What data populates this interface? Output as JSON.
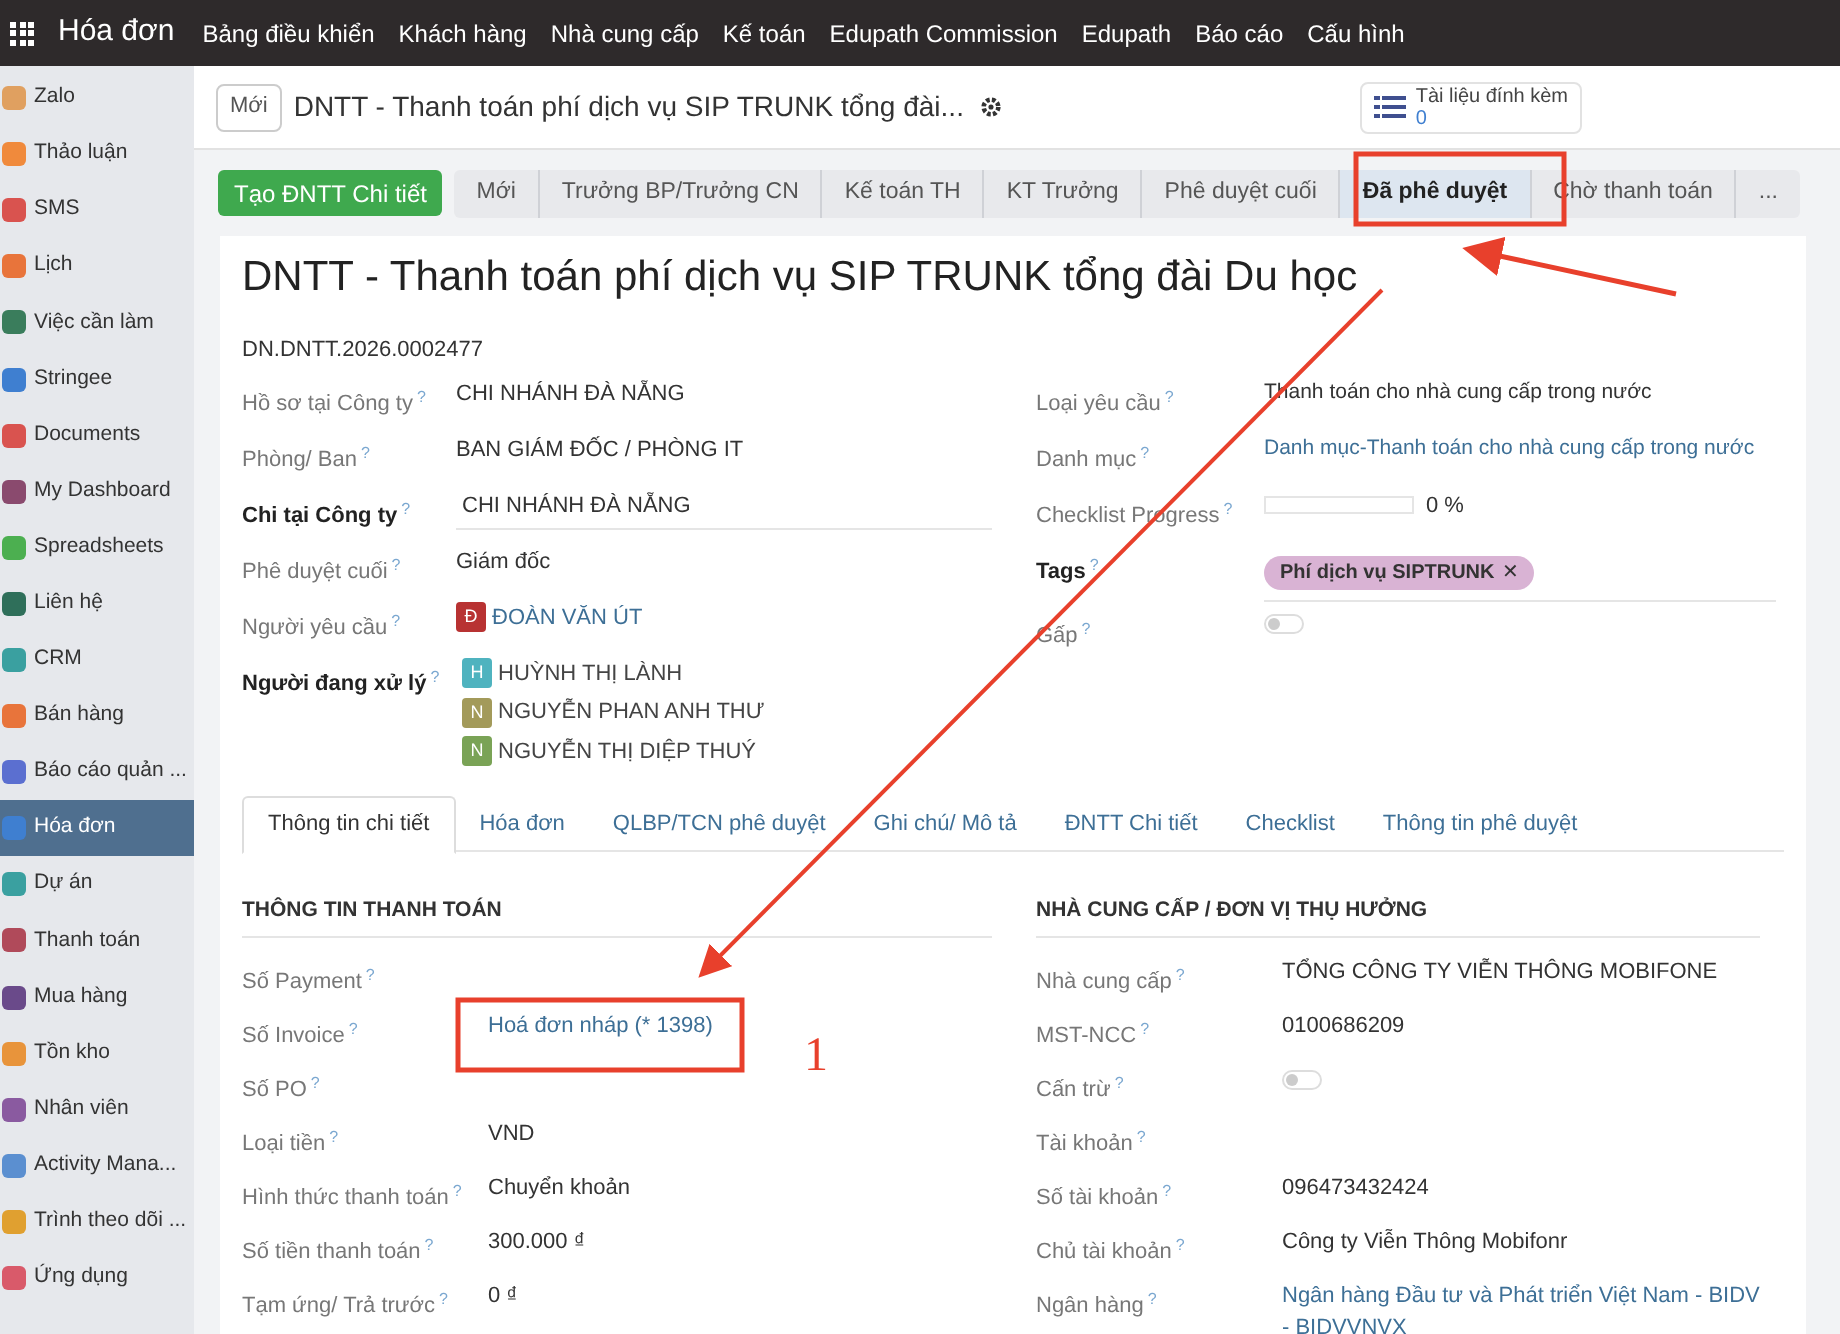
{
  "navbar": {
    "app_name": "Hóa đơn",
    "menu": [
      "Bảng điều khiển",
      "Khách hàng",
      "Nhà cung cấp",
      "Kế toán",
      "Edupath Commission",
      "Edupath",
      "Báo cáo",
      "Cấu hình"
    ]
  },
  "sidebar": {
    "items": [
      {
        "label": "Zalo",
        "color": "#e0a060",
        "selected": false
      },
      {
        "label": "Thảo luận",
        "color": "#f08a3c",
        "selected": false
      },
      {
        "label": "SMS",
        "color": "#d9534f",
        "selected": false
      },
      {
        "label": "Lịch",
        "color": "#e8743b",
        "selected": false
      },
      {
        "label": "Việc cần làm",
        "color": "#3a7d5c",
        "selected": false
      },
      {
        "label": "Stringee",
        "color": "#3f7fd0",
        "selected": false
      },
      {
        "label": "Documents",
        "color": "#d9534f",
        "selected": false
      },
      {
        "label": "My Dashboard",
        "color": "#8a4a6e",
        "selected": false
      },
      {
        "label": "Spreadsheets",
        "color": "#4caf50",
        "selected": false
      },
      {
        "label": "Liên hệ",
        "color": "#2f6f5a",
        "selected": false
      },
      {
        "label": "CRM",
        "color": "#3aa0a0",
        "selected": false
      },
      {
        "label": "Bán hàng",
        "color": "#e8743b",
        "selected": false
      },
      {
        "label": "Báo cáo quản ...",
        "color": "#5b6fd0",
        "selected": false
      },
      {
        "label": "Hóa đơn",
        "color": "#3f7fd0",
        "selected": true
      },
      {
        "label": "Dự án",
        "color": "#3aa0a0",
        "selected": false
      },
      {
        "label": "Thanh toán",
        "color": "#b04a5a",
        "selected": false
      },
      {
        "label": "Mua hàng",
        "color": "#6a4a8a",
        "selected": false
      },
      {
        "label": "Tồn kho",
        "color": "#e8943b",
        "selected": false
      },
      {
        "label": "Nhân viên",
        "color": "#8a5aa0",
        "selected": false
      },
      {
        "label": "Activity Mana...",
        "color": "#5b8fd0",
        "selected": false
      },
      {
        "label": "Trình theo dõi ...",
        "color": "#e0a030",
        "selected": false
      },
      {
        "label": "Ứng dụng",
        "color": "#d95a6a",
        "selected": false
      }
    ]
  },
  "control_panel": {
    "breadcrumb": "Mới",
    "title": "DNTT - Thanh toán phí dịch vụ SIP TRUNK tổng đài...",
    "attachments": {
      "label": "Tài liệu đính kèm",
      "count": "0"
    }
  },
  "action_button": "Tạo ĐNTT Chi tiết",
  "stages": [
    {
      "label": "Mới",
      "selected": false
    },
    {
      "label": "Trưởng BP/Trưởng CN",
      "selected": false
    },
    {
      "label": "Kế toán TH",
      "selected": false
    },
    {
      "label": "KT Trưởng",
      "selected": false
    },
    {
      "label": "Phê duyệt cuối",
      "selected": false
    },
    {
      "label": "Đã phê duyệt",
      "selected": true
    },
    {
      "label": "Chờ thanh toán",
      "selected": false
    },
    {
      "label": "...",
      "selected": false
    }
  ],
  "form": {
    "title": "DNTT - Thanh toán phí dịch vụ SIP TRUNK tổng đài Du học",
    "reference": "DN.DNTT.2026.0002477",
    "left_fields": [
      {
        "label": "Hồ sơ tại Công ty",
        "help": "?",
        "required": false,
        "kind": "text",
        "value": "CHI NHÁNH ĐÀ NẴNG"
      },
      {
        "label": "Phòng/ Ban",
        "help": "?",
        "required": false,
        "kind": "text",
        "value": "BAN GIÁM ĐỐC / PHÒNG IT"
      },
      {
        "label": "Chi tại Công ty",
        "help": "?",
        "required": true,
        "kind": "input",
        "value": "CHI NHÁNH ĐÀ NẴNG"
      },
      {
        "label": "Phê duyệt cuối",
        "help": "?",
        "required": false,
        "kind": "text",
        "value": "Giám đốc"
      },
      {
        "label": "Người yêu cầu",
        "help": "?",
        "required": false,
        "kind": "users",
        "users": [
          {
            "initial": "Đ",
            "name": "ĐOÀN VĂN ÚT",
            "color": "#b83232",
            "link": true
          }
        ]
      },
      {
        "label": "Người đang xử lý",
        "help": "?",
        "required": true,
        "kind": "users",
        "users": [
          {
            "initial": "H",
            "name": "HUỲNH THỊ LÀNH",
            "color": "#4fb3bf",
            "link": false
          },
          {
            "initial": "N",
            "name": "NGUYỄN PHAN ANH THƯ",
            "color": "#a39a5a",
            "link": false
          },
          {
            "initial": "N",
            "name": "NGUYỄN THỊ DIỆP THUÝ",
            "color": "#7aa356",
            "link": false
          }
        ]
      }
    ],
    "right_fields": [
      {
        "label": "Loại yêu cầu",
        "help": "?",
        "required": false,
        "kind": "text",
        "value": "Thanh toán cho nhà cung cấp trong nước"
      },
      {
        "label": "Danh mục",
        "help": "?",
        "required": false,
        "kind": "link",
        "value": "Danh mục-Thanh toán cho nhà cung cấp trong nước"
      },
      {
        "label": "Checklist Progress",
        "help": "?",
        "required": false,
        "kind": "progress",
        "level": 0,
        "value": "0 %"
      },
      {
        "label": "Tags",
        "help": "?",
        "required": true,
        "kind": "tags",
        "tags": [
          {
            "label": "Phí dịch vụ SIPTRUNK",
            "remove": "✕",
            "color": "#d9b3d4"
          }
        ]
      },
      {
        "label": "Gấp",
        "help": "?",
        "required": false,
        "kind": "toggle",
        "on": false
      }
    ]
  },
  "tabs": [
    {
      "label": "Thông tin chi tiết",
      "selected": true
    },
    {
      "label": "Hóa đơn",
      "selected": false
    },
    {
      "label": "QLBP/TCN phê duyệt",
      "selected": false
    },
    {
      "label": "Ghi chú/ Mô tả",
      "selected": false
    },
    {
      "label": "ĐNTT Chi tiết",
      "selected": false
    },
    {
      "label": "Checklist",
      "selected": false
    },
    {
      "label": "Thông tin phê duyệt",
      "selected": false
    }
  ],
  "payment_section": {
    "heading": "THÔNG TIN THANH TOÁN",
    "fields": [
      {
        "label": "Số Payment",
        "help": "?",
        "kind": "empty"
      },
      {
        "label": "Số Invoice",
        "help": "?",
        "kind": "link",
        "value": "Hoá đơn nháp (* 1398)"
      },
      {
        "label": "Số PO",
        "help": "?",
        "kind": "empty"
      },
      {
        "label": "Loại tiền",
        "help": "?",
        "kind": "text",
        "value": "VND"
      },
      {
        "label": "Hình thức thanh toán",
        "help": "?",
        "kind": "text",
        "value": "Chuyển khoản"
      },
      {
        "label": "Số tiền thanh toán",
        "help": "?",
        "kind": "text",
        "value": "300.000 ₫"
      },
      {
        "label": "Tạm ứng/ Trả trước",
        "help": "?",
        "kind": "text",
        "value": "0 ₫"
      }
    ]
  },
  "supplier_section": {
    "heading": "NHÀ CUNG CẤP / ĐƠN VỊ THỤ HƯỞNG",
    "fields": [
      {
        "label": "Nhà cung cấp",
        "help": "?",
        "kind": "text",
        "value": "TỔNG CÔNG TY VIỄN THÔNG MOBIFONE"
      },
      {
        "label": "MST-NCC",
        "help": "?",
        "kind": "text",
        "value": "0100686209"
      },
      {
        "label": "Cấn trừ",
        "help": "?",
        "kind": "toggle",
        "on": false
      },
      {
        "label": "Tài khoản",
        "help": "?",
        "kind": "empty"
      },
      {
        "label": "Số tài khoản",
        "help": "?",
        "kind": "text",
        "value": "096473432424"
      },
      {
        "label": "Chủ tài khoản",
        "help": "?",
        "kind": "text",
        "value": "Công ty Viễn Thông Mobifonr"
      },
      {
        "label": "Ngân hàng",
        "help": "?",
        "kind": "link",
        "value": "Ngân hàng Đầu tư và Phát triển Việt Nam - BIDV - BIDVVNVX"
      }
    ]
  },
  "annotation": {
    "label": "1"
  }
}
